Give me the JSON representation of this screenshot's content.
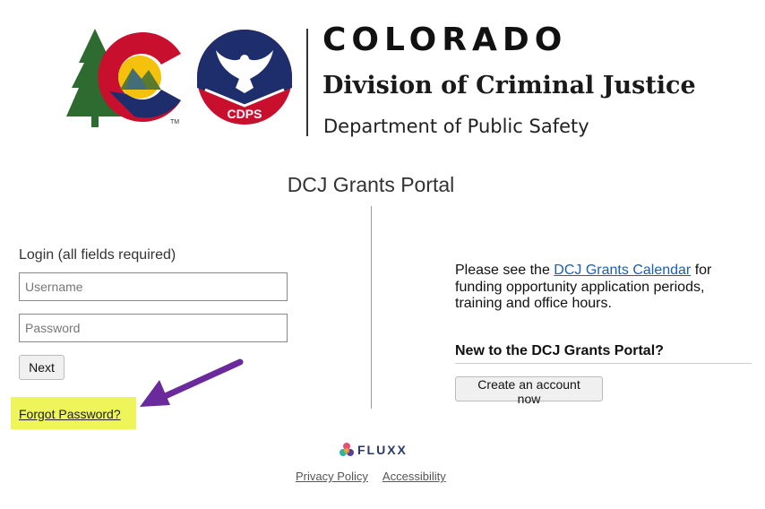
{
  "header": {
    "brand_title": "COLORADO",
    "division": "Division of Criminal Justice",
    "department": "Department of Public Safety",
    "cdps_badge": "CDPS",
    "trademark": "TM"
  },
  "portal_title": "DCJ Grants Portal",
  "login": {
    "label": "Login (all fields required)",
    "username_placeholder": "Username",
    "password_placeholder": "Password",
    "next_label": "Next",
    "forgot_label": "Forgot Password?"
  },
  "info": {
    "prefix": "Please see the ",
    "link": "DCJ Grants Calendar",
    "suffix": " for funding opportunity application periods, training and office hours."
  },
  "signup": {
    "title": "New to the DCJ Grants Portal?",
    "button_label": "Create an account now"
  },
  "footer": {
    "brand": "FLUXX",
    "privacy": "Privacy Policy",
    "accessibility": "Accessibility"
  },
  "colors": {
    "highlight": "#eef55a",
    "arrow": "#6a2a9c",
    "link": "#1a5eb8",
    "colorado_red": "#c8102e",
    "colorado_blue": "#1e2d6b",
    "colorado_green": "#2e6b30",
    "colorado_gold": "#f4c20d"
  },
  "icons": [
    "colorado-logo-icon",
    "cdps-eagle-logo-icon",
    "annotation-arrow-icon",
    "fluxx-logo-icon"
  ]
}
